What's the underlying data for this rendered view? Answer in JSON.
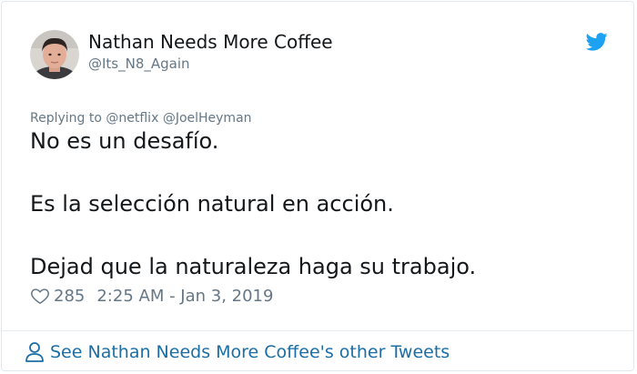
{
  "tweet": {
    "author": {
      "display_name": "Nathan Needs More Coffee",
      "handle": "@Its_N8_Again",
      "avatar_icon": "avatar-photo"
    },
    "platform_icon": "twitter-bird-icon",
    "reply_context": {
      "prefix": "Replying to",
      "mentions": [
        "@netflix",
        "@JoelHeyman"
      ]
    },
    "paragraphs": [
      "No es un desafío.",
      "Es la selección natural en acción.",
      "Dejad que la naturaleza haga su trabajo."
    ],
    "likes": "285",
    "timestamp": "2:25 AM - Jan 3, 2019"
  },
  "footer": {
    "link_text": "See Nathan Needs More Coffee's other Tweets",
    "icon": "person-icon"
  },
  "colors": {
    "text_primary": "#14171a",
    "text_secondary": "#657786",
    "twitter_blue": "#1da1f2",
    "link_blue": "#1b6ea5",
    "border": "#e1e8ed"
  }
}
